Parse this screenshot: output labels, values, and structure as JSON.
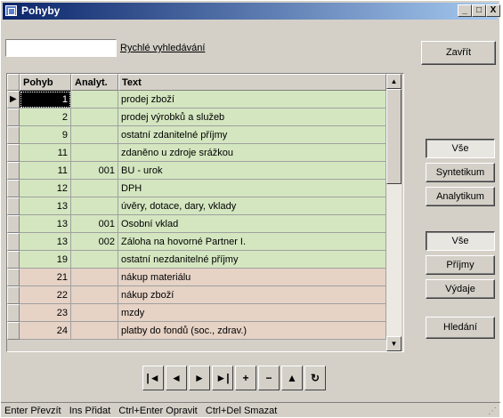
{
  "window": {
    "title": "Pohyby",
    "minimize": "_",
    "maximize": "□",
    "close": "X"
  },
  "search": {
    "value": "",
    "label": "Rychlé vyhledávání"
  },
  "buttons": {
    "close": "Zavřít",
    "filter1": [
      "Vše",
      "Syntetikum",
      "Analytikum"
    ],
    "filter2": [
      "Vše",
      "Příjmy",
      "Výdaje"
    ],
    "find": "Hledání"
  },
  "grid": {
    "columns": [
      "Pohyb",
      "Analyt.",
      "Text"
    ],
    "rows": [
      {
        "pohyb": "1",
        "analyt": "",
        "text": "prodej zboží",
        "group": "income"
      },
      {
        "pohyb": "2",
        "analyt": "",
        "text": "prodej výrobků a služeb",
        "group": "income"
      },
      {
        "pohyb": "9",
        "analyt": "",
        "text": "ostatní zdanitelné příjmy",
        "group": "income"
      },
      {
        "pohyb": "11",
        "analyt": "",
        "text": "zdaněno u zdroje srážkou",
        "group": "income"
      },
      {
        "pohyb": "11",
        "analyt": "001",
        "text": "BU - urok",
        "group": "income"
      },
      {
        "pohyb": "12",
        "analyt": "",
        "text": "DPH",
        "group": "income"
      },
      {
        "pohyb": "13",
        "analyt": "",
        "text": "úvěry, dotace, dary, vklady",
        "group": "income"
      },
      {
        "pohyb": "13",
        "analyt": "001",
        "text": "Osobní vklad",
        "group": "income"
      },
      {
        "pohyb": "13",
        "analyt": "002",
        "text": "Záloha na hovorné Partner I.",
        "group": "income"
      },
      {
        "pohyb": "19",
        "analyt": "",
        "text": "ostatní nezdanitelné příjmy",
        "group": "income"
      },
      {
        "pohyb": "21",
        "analyt": "",
        "text": "nákup materiálu",
        "group": "expense"
      },
      {
        "pohyb": "22",
        "analyt": "",
        "text": "nákup zboží",
        "group": "expense"
      },
      {
        "pohyb": "23",
        "analyt": "",
        "text": "mzdy",
        "group": "expense"
      },
      {
        "pohyb": "24",
        "analyt": "",
        "text": "platby do fondů (soc., zdrav.)",
        "group": "expense"
      }
    ]
  },
  "colors": {
    "income": "#d4e6c0",
    "expense": "#e6d3c6"
  },
  "navigator": {
    "first": "|◄",
    "prior": "◄",
    "next": "►",
    "last": "►|",
    "insert": "+",
    "delete": "−",
    "edit": "▲",
    "refresh": "↻"
  },
  "statusbar": {
    "text": "Enter Převzít   Ins Přidat   Ctrl+Enter Opravit   Ctrl+Del Smazat"
  }
}
